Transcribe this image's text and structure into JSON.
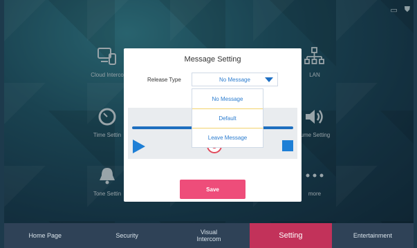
{
  "status_icons": [
    "screen-mirror-icon",
    "shield-icon"
  ],
  "tiles": {
    "cloud_intercom": "Cloud Interco",
    "lan": "LAN",
    "time_setting": "Time Settin",
    "volume_setting": "lume Setting",
    "tone_setting": "Tone Settin",
    "more": "more"
  },
  "dialog": {
    "title": "Message Setting",
    "release_type_label": "Release Type",
    "selected_value": "No Message",
    "save_label": "Save"
  },
  "dropdown": {
    "options": [
      "No Message",
      "Default",
      "Leave Message"
    ]
  },
  "navbar": {
    "items": [
      "Home Page",
      "Security",
      "Visual\nIntercom",
      "Setting",
      "Entertainment"
    ],
    "active": "Setting"
  },
  "colors": {
    "accent_blue": "#1e7fd6",
    "save_pink": "#ee4d7a",
    "active_tab": "#c2325a",
    "record_red": "#e14a5b"
  }
}
